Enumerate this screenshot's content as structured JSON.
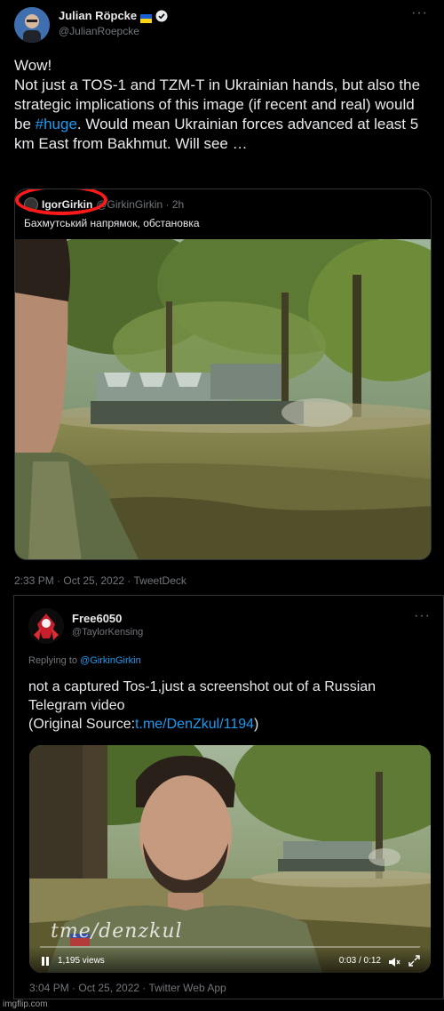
{
  "tweet1": {
    "display_name": "Julian Röpcke",
    "handle": "@JulianRoepcke",
    "text_before_hashtag": "Wow!\nNot just a TOS-1 and TZM-T in Ukrainian hands, but also the strategic implications of this image (if recent and real) would be ",
    "hashtag": "#huge",
    "text_after_hashtag": ". Would mean Ukrainian forces advanced at least 5 km East from Bakhmut. Will see …",
    "meta": "2:33 PM · Oct 25, 2022 · TweetDeck",
    "quote": {
      "display_name": "IgorGirkin",
      "handle": "@GirkinGirkin · 2h",
      "text": "Бахмутський напрямок, обстановка"
    }
  },
  "tweet2": {
    "display_name": "Free6050",
    "handle": "@TaylorKensing",
    "replying_prefix": "Replying to ",
    "replying_to": "@GirkinGirkin",
    "text": "not a captured Tos-1,just a screenshot out of a Russian Telegram video\n(Original Source:",
    "link": "t.me/DenZkul/1194",
    "text_end": ")",
    "video": {
      "views": "1,195 views",
      "time": "0:03 / 0:12",
      "watermark": "tme/denzkul"
    },
    "meta": "3:04 PM · Oct 25, 2022 · Twitter Web App"
  },
  "footer": {
    "watermark": "imgflip.com"
  },
  "icons": {
    "verified": "verified-badge-icon",
    "flag": "ukraine-flag-icon",
    "more": "more-options-icon",
    "play": "play-icon",
    "volume": "volume-icon",
    "expand": "expand-icon"
  },
  "colors": {
    "accent": "#1d9bf0",
    "muted": "#71767b",
    "highlight": "#ff1a1a"
  }
}
